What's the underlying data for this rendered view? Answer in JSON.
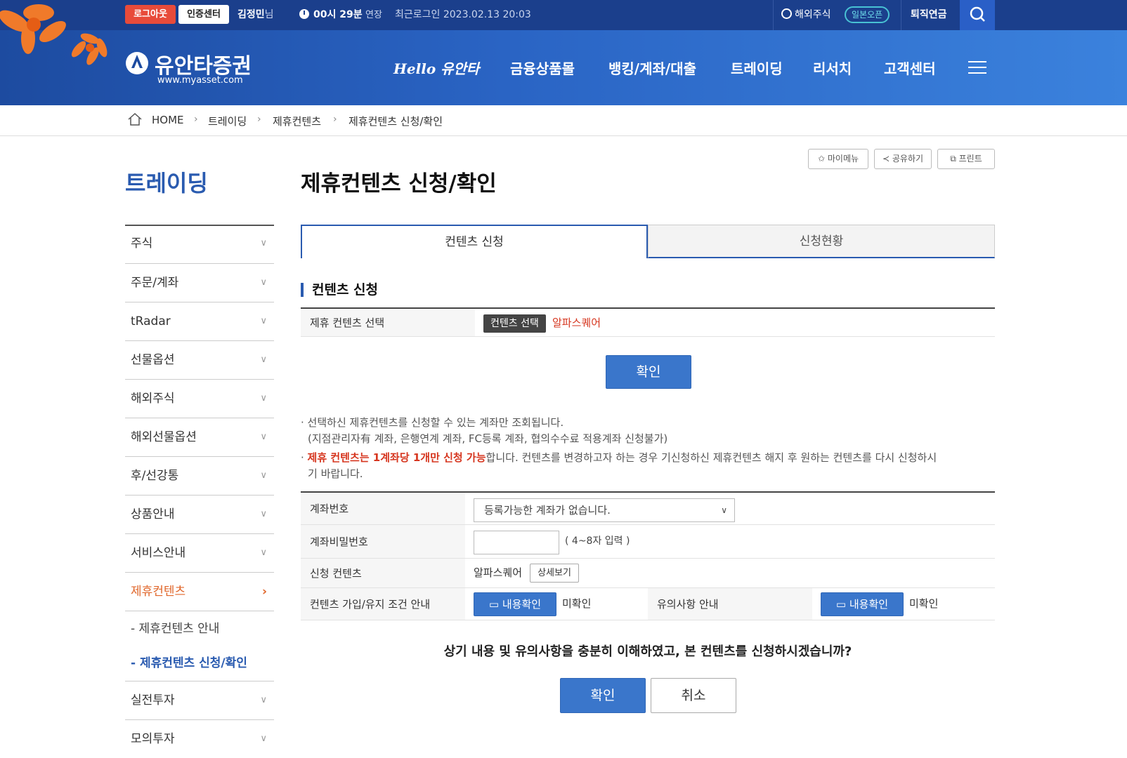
{
  "topbar": {
    "logout": "로그아웃",
    "cert": "인증센터",
    "user_name": "김정민",
    "user_suffix": "님",
    "timer": "00시 29분",
    "extend": "연장",
    "last_login": "최근로그인 2023.02.13 20:03",
    "overseas": "해외주식",
    "badge": "일본오픈",
    "pension": "퇴직연금"
  },
  "logo": {
    "name": "유안타증권",
    "url": "www.myasset.com"
  },
  "nav": [
    "Hello 유안타",
    "금융상품몰",
    "뱅킹/계좌/대출",
    "트레이딩",
    "리서치",
    "고객센터"
  ],
  "breadcrumb": [
    "HOME",
    "트레이딩",
    "제휴컨텐츠",
    "제휴컨텐츠 신청/확인"
  ],
  "sidebar": {
    "title": "트레이딩",
    "items": [
      "주식",
      "주문/계좌",
      "tRadar",
      "선물옵션",
      "해외주식",
      "해외선물옵션",
      "후/선강통",
      "상품안내",
      "서비스안내",
      "제휴컨텐츠"
    ],
    "subitems": [
      "- 제휴컨텐츠 안내",
      "- 제휴컨텐츠 신청/확인"
    ],
    "items_after": [
      "실전투자",
      "모의투자"
    ]
  },
  "page": {
    "title": "제휴컨텐츠 신청/확인",
    "util": [
      "마이메뉴",
      "공유하기",
      "프린트"
    ],
    "tabs": [
      "컨텐츠 신청",
      "신청현황"
    ],
    "section_title": "컨텐츠 신청",
    "select_label": "제휴 컨텐츠 선택",
    "select_button": "컨텐츠 선택",
    "selected_value": "알파스퀘어",
    "confirm": "확인",
    "notes": {
      "line1": "선택하신 제휴컨텐츠를 신청할 수 있는 계좌만 조회됩니다.",
      "line2": "(지점관리자有 계좌, 은행연계 계좌, FC등록 계좌, 협의수수료 적용계좌 신청불가)",
      "line3_red": "제휴 컨텐츠는 1계좌당 1개만 신청 가능",
      "line3_rest": "합니다. 컨텐츠를 변경하고자 하는 경우 기신청하신 제휴컨텐츠 해지 후 원하는 컨텐츠를 다시 신청하시",
      "line4": "기 바랍니다."
    },
    "form": {
      "account_label": "계좌번호",
      "account_value": "등록가능한 계좌가 없습니다.",
      "password_label": "계좌비밀번호",
      "password_hint": "( 4~8자 입력 )",
      "content_label": "신청 컨텐츠",
      "content_value": "알파스퀘어",
      "detail_button": "상세보기",
      "terms_label": "컨텐츠 가입/유지 조건 안내",
      "check_button": "내용확인",
      "unchecked": "미확인",
      "caution_label": "유의사항 안내"
    },
    "question": "상기 내용 및 유의사항을 충분히 이해하였고, 본 컨텐츠를 신청하시겠습니까?",
    "ok": "확인",
    "cancel": "취소"
  }
}
